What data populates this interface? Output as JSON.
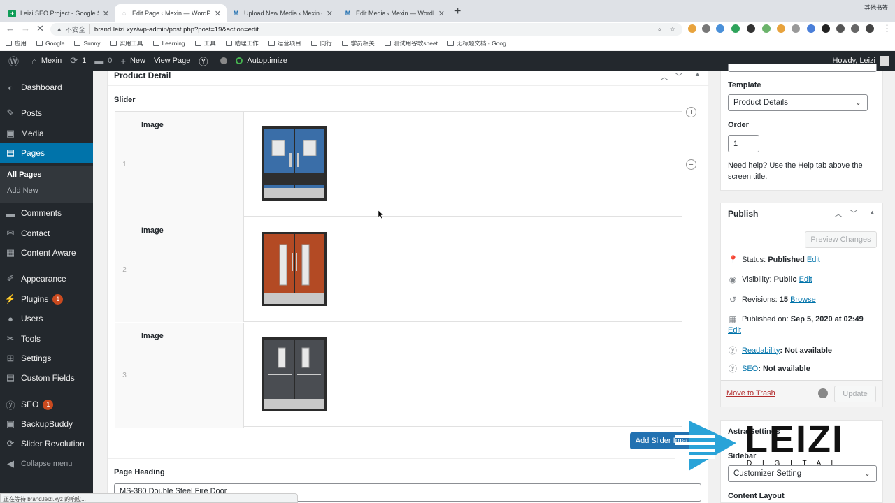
{
  "browser": {
    "tabs": [
      {
        "title": "Leizi SEO Project - Google She",
        "fav": "+",
        "fav_color": "#0f9d58"
      },
      {
        "title": "Edit Page ‹ Mexin — WordPress",
        "fav": "◌",
        "fav_color": "#5f6368"
      },
      {
        "title": "Upload New Media ‹ Mexin — V",
        "fav": "M",
        "fav_color": "#2271b1"
      },
      {
        "title": "Edit Media ‹ Mexin — WordPre",
        "fav": "M",
        "fav_color": "#2271b1"
      }
    ],
    "new_tab": "+",
    "insecure_label": "不安全",
    "url": "brand.leizi.xyz/wp-admin/post.php?post=19&action=edit",
    "bookmarks": [
      "应用",
      "Google",
      "Sunny",
      "实用工具",
      "Learning",
      "工具",
      "助理工作",
      "运营项目",
      "同行",
      "学员相关",
      "测试用谷歌sheet",
      "无标题文档 - Goog..."
    ],
    "other_bookmarks": "其他书签",
    "status": "正在等待 brand.leizi.xyz 的响应..."
  },
  "adminbar": {
    "site": "Mexin",
    "updates": "1",
    "comments": "0",
    "new_label": "New",
    "view_page": "View Page",
    "autoptimize": "Autoptimize",
    "howdy": "Howdy, Leizi"
  },
  "sidebar": {
    "items": [
      {
        "label": "Dashboard",
        "icon": "dashboard-icon"
      },
      {
        "label": "Posts",
        "icon": "pin-icon"
      },
      {
        "label": "Media",
        "icon": "media-icon"
      },
      {
        "label": "Pages",
        "icon": "pages-icon"
      },
      {
        "label": "Comments",
        "icon": "comment-icon"
      },
      {
        "label": "Contact",
        "icon": "mail-icon"
      },
      {
        "label": "Content Aware",
        "icon": "content-icon"
      },
      {
        "label": "Appearance",
        "icon": "brush-icon"
      },
      {
        "label": "Plugins",
        "icon": "plugin-icon",
        "badge": "1"
      },
      {
        "label": "Users",
        "icon": "user-icon"
      },
      {
        "label": "Tools",
        "icon": "wrench-icon"
      },
      {
        "label": "Settings",
        "icon": "settings-icon"
      },
      {
        "label": "Custom Fields",
        "icon": "fields-icon"
      },
      {
        "label": "SEO",
        "icon": "yoast-icon",
        "badge": "1"
      },
      {
        "label": "BackupBuddy",
        "icon": "backup-icon"
      },
      {
        "label": "Slider Revolution",
        "icon": "refresh-icon"
      },
      {
        "label": "Collapse menu",
        "icon": "collapse-icon"
      }
    ],
    "submenu": {
      "all_pages": "All Pages",
      "add_new": "Add New"
    }
  },
  "main": {
    "box_title": "Product Detail",
    "slider_label": "Slider",
    "rows": [
      {
        "num": "1",
        "label": "Image",
        "door_color": "#3a6ea8"
      },
      {
        "num": "2",
        "label": "Image",
        "door_color": "#b34a24"
      },
      {
        "num": "3",
        "label": "Image",
        "door_color": "#4a4d52"
      }
    ],
    "add_button": "Add Slider Image",
    "page_heading_label": "Page Heading",
    "page_heading_value": "MS-380 Double Steel Fire Door"
  },
  "attributes": {
    "template_label": "Template",
    "template_value": "Product Details",
    "order_label": "Order",
    "order_value": "1",
    "help": "Need help? Use the Help tab above the screen title."
  },
  "publish": {
    "title": "Publish",
    "preview": "Preview Changes",
    "status_label": "Status:",
    "status_value": "Published",
    "visibility_label": "Visibility:",
    "visibility_value": "Public",
    "revisions_label": "Revisions:",
    "revisions_value": "15",
    "browse": "Browse",
    "published_label": "Published on:",
    "published_value": "Sep 5, 2020 at 02:49",
    "edit": "Edit",
    "readability_link": "Readability",
    "readability_value": ": Not available",
    "seo_link": "SEO",
    "seo_value": ": Not available",
    "trash": "Move to Trash",
    "update": "Update"
  },
  "astra": {
    "title": "Astra Settings",
    "sidebar_label": "Sidebar",
    "sidebar_value": "Customizer Setting",
    "content_layout_label": "Content Layout"
  },
  "watermark": {
    "word": "LEIZI",
    "sub": "D I G I T A L"
  }
}
